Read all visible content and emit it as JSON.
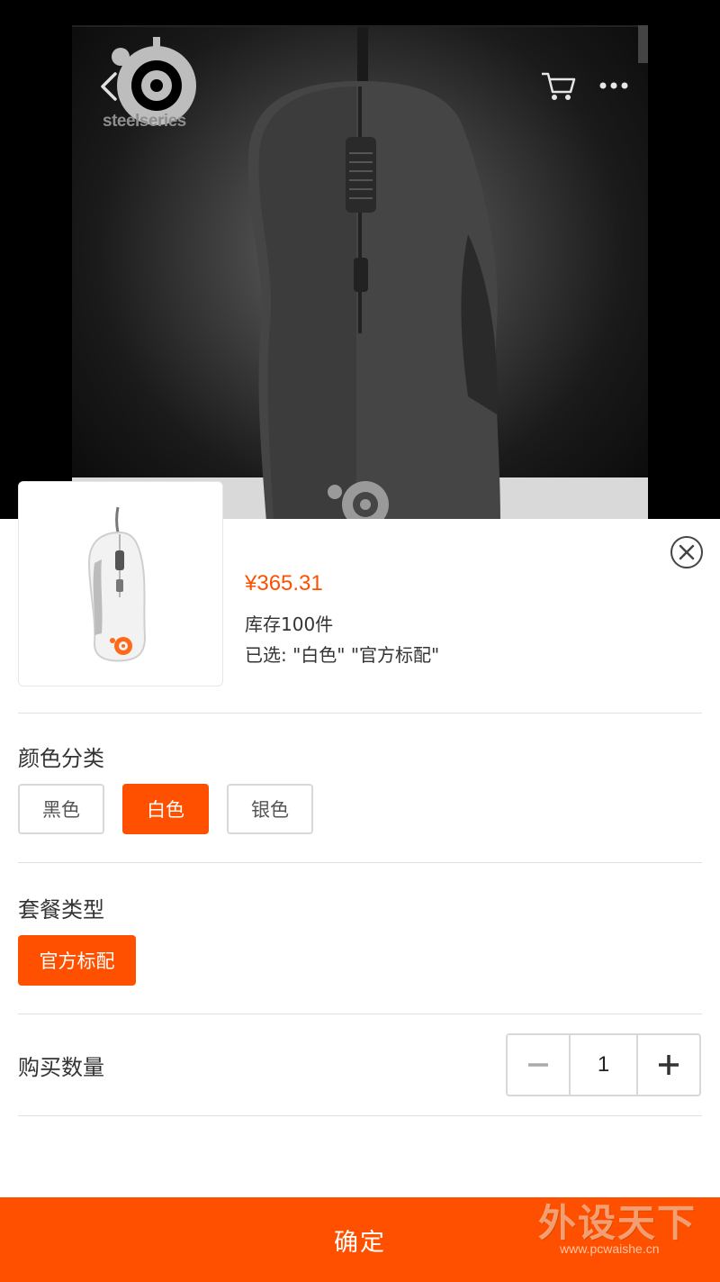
{
  "header": {
    "brand_text": "steelseries",
    "back_icon": "chevron-left-icon",
    "cart_icon": "cart-icon",
    "more_icon": "more-dots-icon"
  },
  "product": {
    "price": "¥365.31",
    "stock": "库存100件",
    "selected": "已选: \"白色\" \"官方标配\""
  },
  "color_section": {
    "title": "颜色分类",
    "options": [
      "黑色",
      "白色",
      "银色"
    ],
    "selected": "白色"
  },
  "package_section": {
    "title": "套餐类型",
    "options": [
      "官方标配"
    ],
    "selected": "官方标配"
  },
  "quantity": {
    "label": "购买数量",
    "value": "1",
    "minus": "−",
    "plus": "+"
  },
  "confirm_label": "确定",
  "watermark": {
    "title": "外设天下",
    "url": "www.pcwaishe.cn"
  },
  "colors": {
    "accent": "#ff5000",
    "text": "#333333",
    "border": "#d8d8d8"
  }
}
